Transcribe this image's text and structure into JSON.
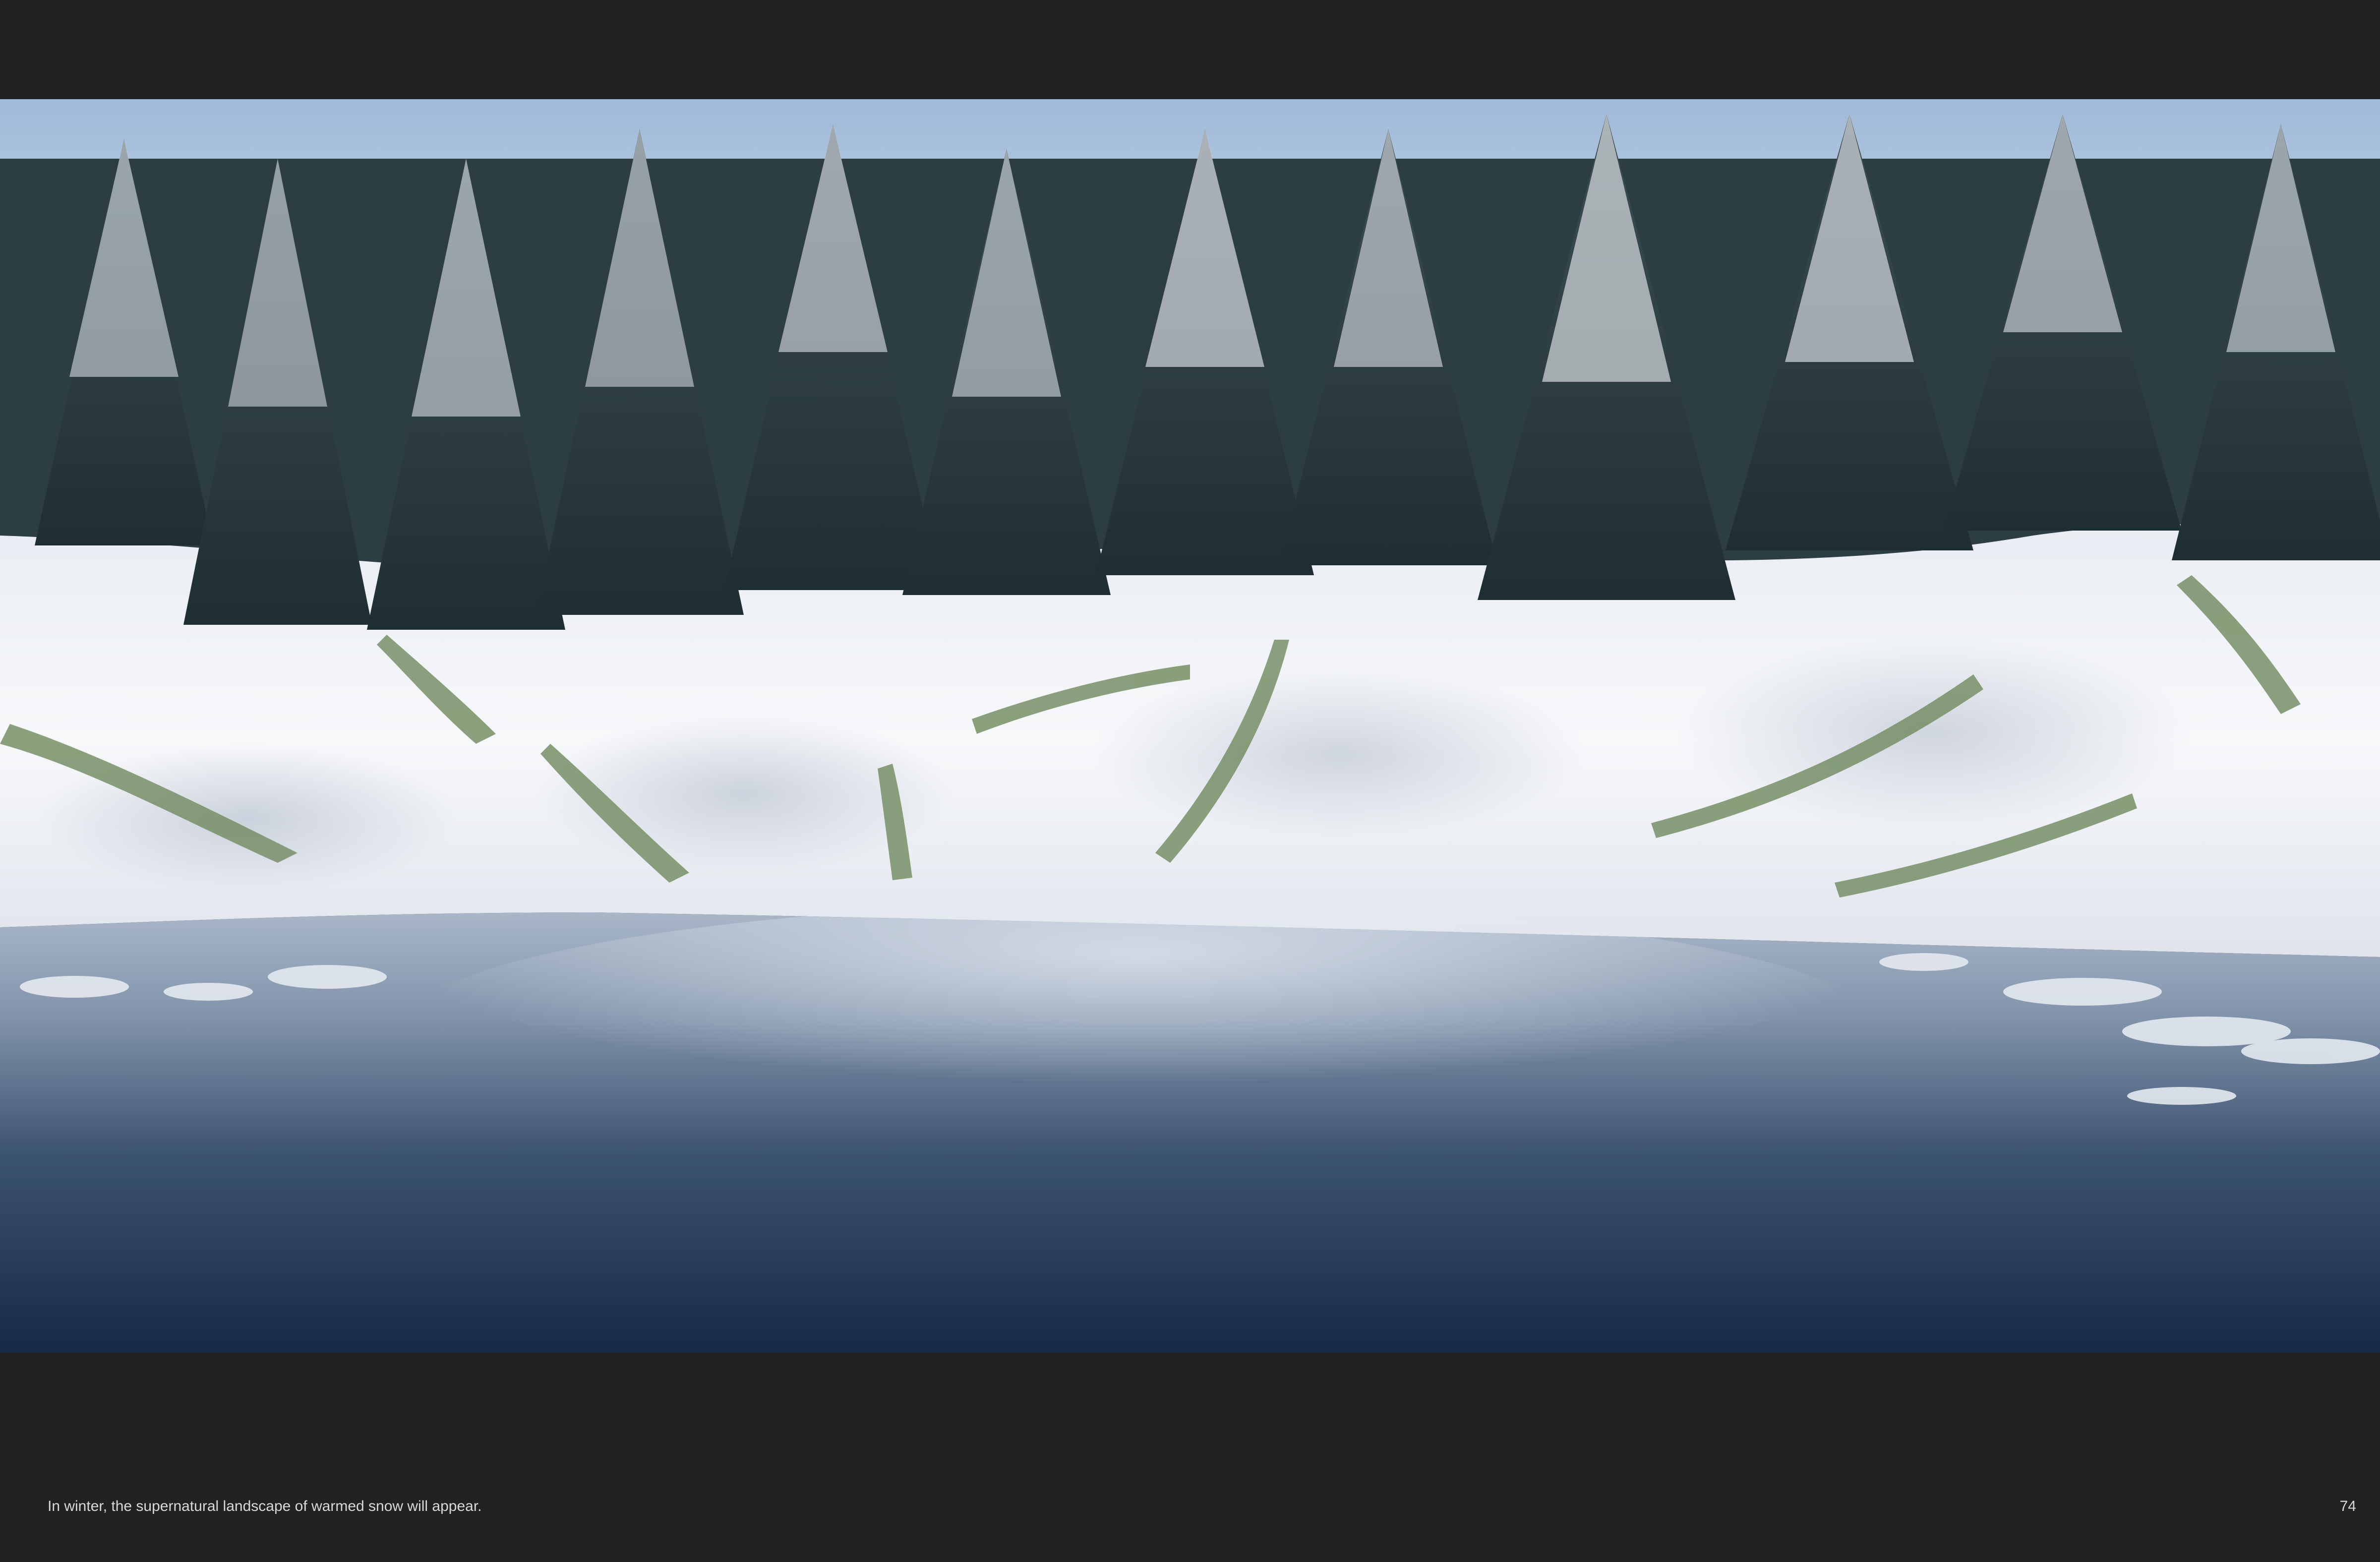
{
  "page": {
    "caption": "In winter, the supernatural landscape of warmed snow will appear.",
    "page_number": "74",
    "background_color": "#222222"
  },
  "image": {
    "subject": "snowy-forest-lake-render"
  }
}
